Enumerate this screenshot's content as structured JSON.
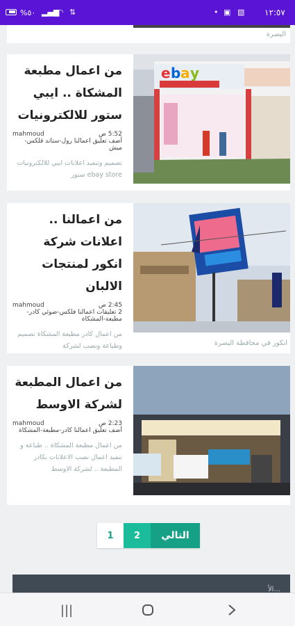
{
  "status_bar": {
    "time": "١٢:٥٧",
    "battery": "%٥٠",
    "icons": [
      "battery-icon",
      "signal-icon",
      "wifi-icon",
      "lte-icon",
      "dot-icon",
      "screenshot-icon",
      "gallery-icon"
    ]
  },
  "prev_card": {
    "text": "البصرة"
  },
  "articles": [
    {
      "title": "من اعمال مطبعة المشكاة .. ايبي ستور للالكترونيات",
      "author": "mahmoud",
      "time": "5:52 ص",
      "meta": "أضف تعليق اعمالنا رول-ستاند فلكس-ميش",
      "excerpt": "تصميم وتنفيذ اعلانات ايبي للالكترونيات ebay store ستور"
    },
    {
      "title": "من اعمالنا .. اعلانات شركة انكور لمنتجات الالبان",
      "author": "mahmoud",
      "time": "2:45 ص",
      "meta": "2 تعليقات اعمالنا فلكس-ضوئي كادر-مطبعة-المشكاة",
      "excerpt": "من اعمال كادر مطبعة المشكاة تصميم وطباعة ونصب لشركة",
      "caption": "انكور في محافظة البصرة"
    },
    {
      "title": "من اعمال المطبعة لشركة الاوسط",
      "author": "mahmoud",
      "time": "2:23 ص",
      "meta": "أضف تعليق اعمالنا كادر-مطبعة-المشكاة",
      "excerpt": "من اعمال مطبعة المشكاة .. طباعة و تنفيذ اعمال نصب الاعلانات بكادر المطبعة .. لشركة الاوسط"
    }
  ],
  "pagination": {
    "page1": "1",
    "page2": "2",
    "next": "التالي"
  },
  "footer_peek": {
    "text": "الأ..."
  },
  "colors": {
    "status_bar": "#5a14d6",
    "accent": "#16a085",
    "accent_light": "#1abc9c"
  }
}
